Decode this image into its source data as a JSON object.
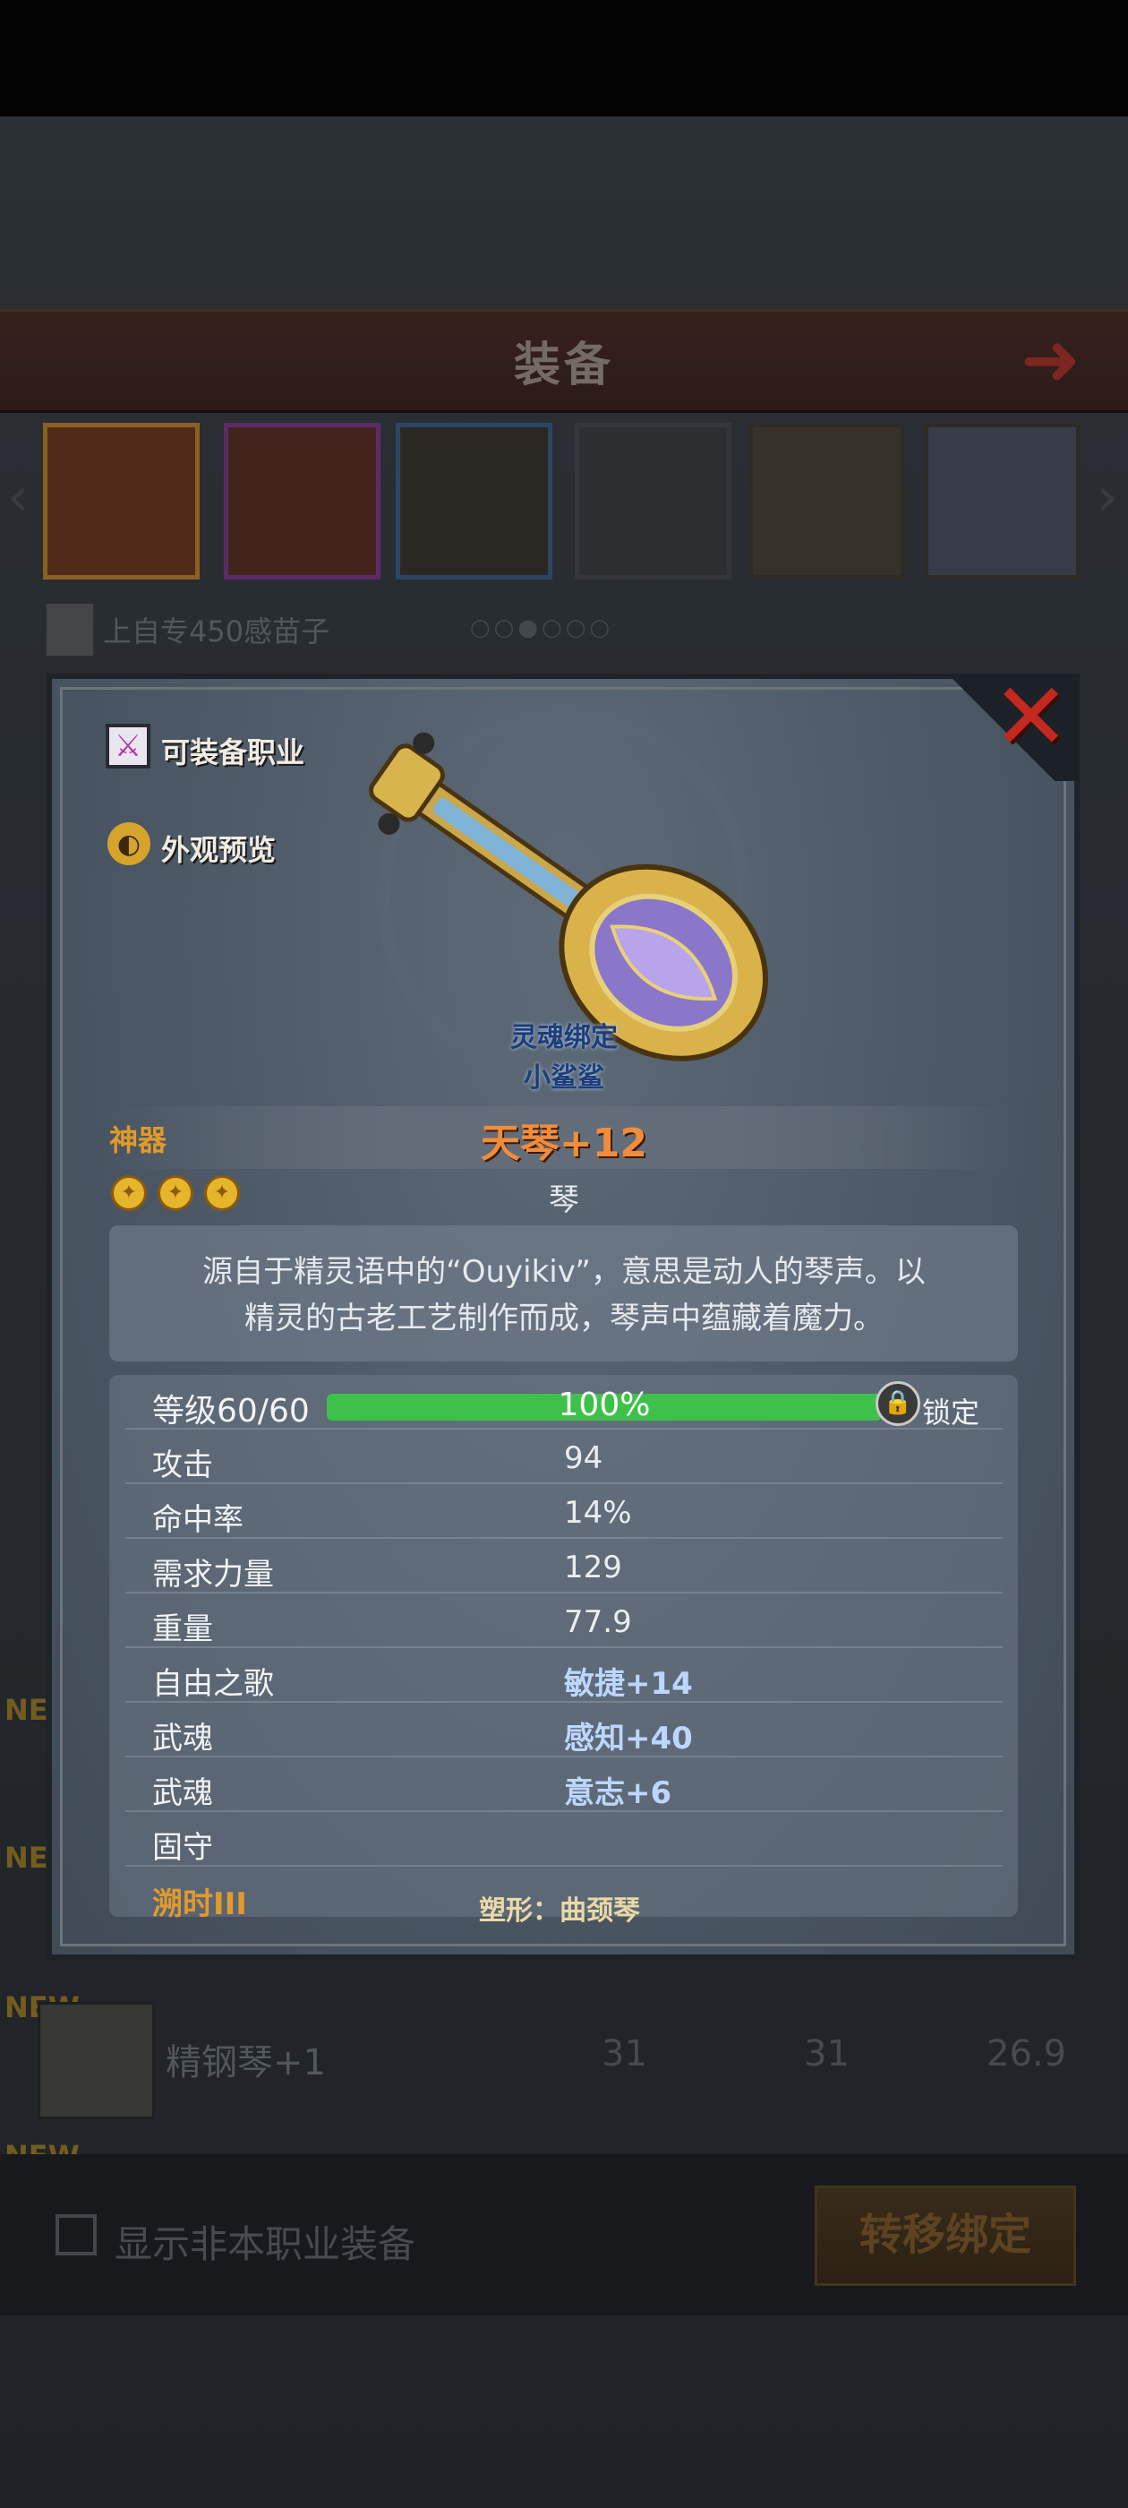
{
  "background": {
    "title": "装备",
    "owner_text": "上自专450感苗子",
    "page_dots": "○○●○○○",
    "new_tags": [
      "NEW",
      "NEW",
      "NEW",
      "NEW"
    ],
    "list_row": {
      "name": "精钢琴+1",
      "col1": "31",
      "col2": "31",
      "col3": "26.9"
    },
    "show_other_jobs_label": "显示非本职业装备",
    "transfer_bind_label": "转移绑定"
  },
  "modal": {
    "close_icon": "close-x-icon",
    "job_label": "可装备职业",
    "appearance_label": "外观预览",
    "soulbound": "灵魂绑定",
    "owner_name": "小鲨鲨",
    "rarity": "神器",
    "item_name": "天琴+12",
    "stars": 3,
    "item_type": "琴",
    "description_line1": "源自于精灵语中的“Ouyikiv”，意思是动人的琴声。以",
    "description_line2": "精灵的古老工艺制作而成，琴声中蕴藏着魔力。",
    "level_label": "等级60/60",
    "level_progress": 1.0,
    "level_percent": "100%",
    "lock_label": "锁定",
    "stats": [
      {
        "label": "攻击",
        "value": "94",
        "bonus": false
      },
      {
        "label": "命中率",
        "value": "14%",
        "bonus": false
      },
      {
        "label": "需求力量",
        "value": "129",
        "bonus": false
      },
      {
        "label": "重量",
        "value": "77.9",
        "bonus": false
      },
      {
        "label": "自由之歌",
        "value": "敏捷+14",
        "bonus": true
      },
      {
        "label": "武魂",
        "value": "感知+40",
        "bonus": true
      },
      {
        "label": "武魂",
        "value": "意志+6",
        "bonus": true
      },
      {
        "label": "固守",
        "value": "",
        "bonus": false
      }
    ],
    "era_label": "溯时III",
    "shape_label": "塑形：曲颈琴"
  },
  "colors": {
    "accent_orange": "#f08d3b",
    "close_red": "#c4281f",
    "progress_green": "#3ec14a",
    "bonus_blue": "#bcd6ff"
  }
}
